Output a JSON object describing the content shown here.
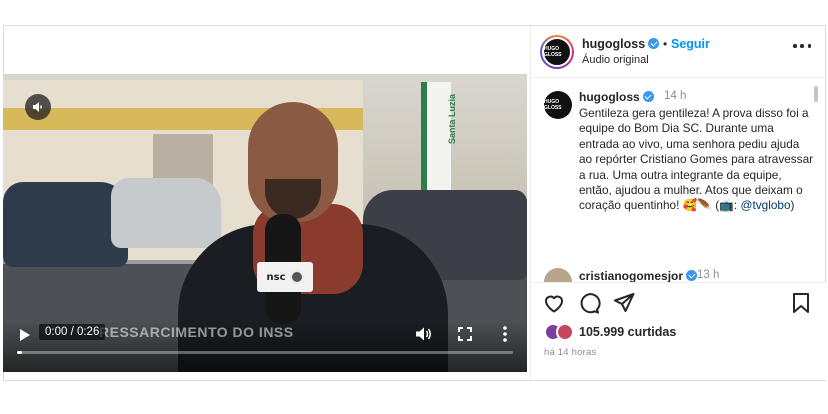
{
  "post": {
    "username": "hugogloss",
    "follow_label": "Seguir",
    "audio_label": "Áudio original",
    "avatar_text": "HUGO GLOSS"
  },
  "video": {
    "current_time": "0:00 / 0:26",
    "lower_third": "RESSARCIMENTO DO INSS",
    "mic_flag": "nsc",
    "street_sign": "Santa Luzia",
    "progress": 0.01
  },
  "caption": {
    "username": "hugogloss",
    "time": "14 h",
    "text_main": "Gentileza gera gentileza! A prova disso foi a equipe do Bom Dia SC. Durante uma entrada ao vivo, uma senhora pediu ajuda ao repórter Cristiano Gomes para atravessar a rua. Uma outra integrante da equipe, então, ajudou a mulher. Atos que deixam o coração quentinho! 🥰🪶",
    "text_credit_prefix": "(📺: ",
    "text_credit_handle": "@tvglobo",
    "text_credit_suffix": ")"
  },
  "next_comment": {
    "username": "cristianogomesjor",
    "time": "13 h"
  },
  "actions": {
    "likes": "105.999 curtidas",
    "posted_ago": "há 14 horas"
  },
  "colors": {
    "accent_blue": "#0095f6",
    "verified_blue": "#3897f0",
    "text": "#262626",
    "muted": "#8e8e8e"
  },
  "icons": [
    "volume-muted-icon",
    "play-icon",
    "volume-icon",
    "fullscreen-icon",
    "more-vertical-icon",
    "more-horizontal-icon",
    "heart-icon",
    "comment-icon",
    "share-icon",
    "bookmark-icon",
    "verified-badge-icon"
  ]
}
